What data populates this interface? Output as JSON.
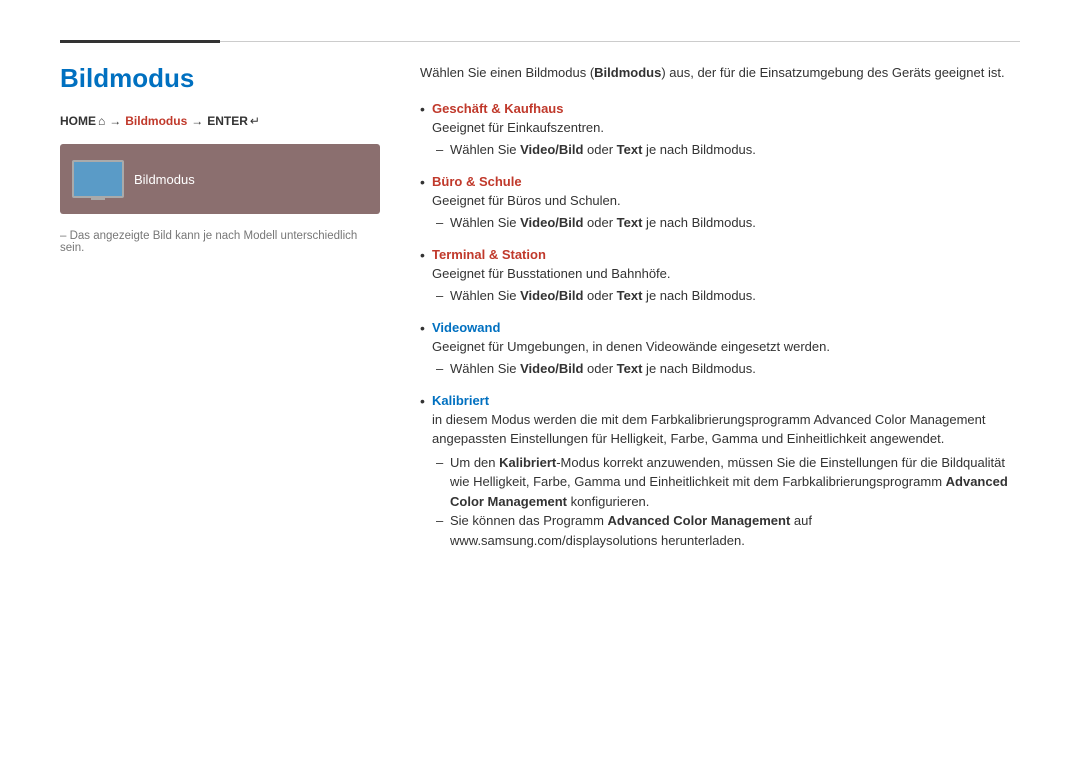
{
  "page": {
    "title": "Bildmodus",
    "top_divider": true
  },
  "nav": {
    "home_label": "HOME",
    "home_icon": "⌂",
    "arrow": "→",
    "link_label": "Bildmodus",
    "enter_label": "ENTER",
    "enter_icon": "↵"
  },
  "preview": {
    "label": "Bildmodus"
  },
  "note": {
    "text": "– Das angezeigte Bild kann je nach Modell unterschiedlich sein."
  },
  "intro": {
    "text": "Wählen Sie einen Bildmodus (Bildmodus) aus, der für die Einsatzumgebung des Geräts geeignet ist."
  },
  "sections": [
    {
      "id": "geschaeft",
      "title": "Geschäft & Kaufhaus",
      "title_color": "red",
      "desc": "Geeignet für Einkaufszentren.",
      "sub_items": [
        "Wählen Sie Video/Bild oder Text je nach Bildmodus."
      ]
    },
    {
      "id": "buero",
      "title": "Büro & Schule",
      "title_color": "red",
      "desc": "Geeignet für Büros und Schulen.",
      "sub_items": [
        "Wählen Sie Video/Bild oder Text je nach Bildmodus."
      ]
    },
    {
      "id": "terminal",
      "title": "Terminal & Station",
      "title_color": "red",
      "desc": "Geeignet für Busstationen und Bahnhöfe.",
      "sub_items": [
        "Wählen Sie Video/Bild oder Text je nach Bildmodus."
      ]
    },
    {
      "id": "videowand",
      "title": "Videowand",
      "title_color": "blue",
      "desc": "Geeignet für Umgebungen, in denen Videowände eingesetzt werden.",
      "sub_items": [
        "Wählen Sie Video/Bild oder Text je nach Bildmodus."
      ]
    },
    {
      "id": "kalibriert",
      "title": "Kalibriert",
      "title_color": "blue",
      "desc": "in diesem Modus werden die mit dem Farbkalibrierungsprogramm Advanced Color Management angepassten Einstellungen für Helligkeit, Farbe, Gamma und Einheitlichkeit angewendet.",
      "sub_items": [
        "Um den Kalibriert-Modus korrekt anzuwenden, müssen Sie die Einstellungen für die Bildqualität wie Helligkeit, Farbe, Gamma und Einheitlichkeit mit dem Farbkalibrierungsprogramm Advanced Color Management konfigurieren.",
        "Sie können das Programm Advanced Color Management auf www.samsung.com/displaysolutions herunterladen."
      ]
    }
  ],
  "labels": {
    "video_bild": "Video/Bild",
    "text": "Text",
    "advanced_color": "Advanced Color Management",
    "kalibriert": "Kalibriert"
  }
}
